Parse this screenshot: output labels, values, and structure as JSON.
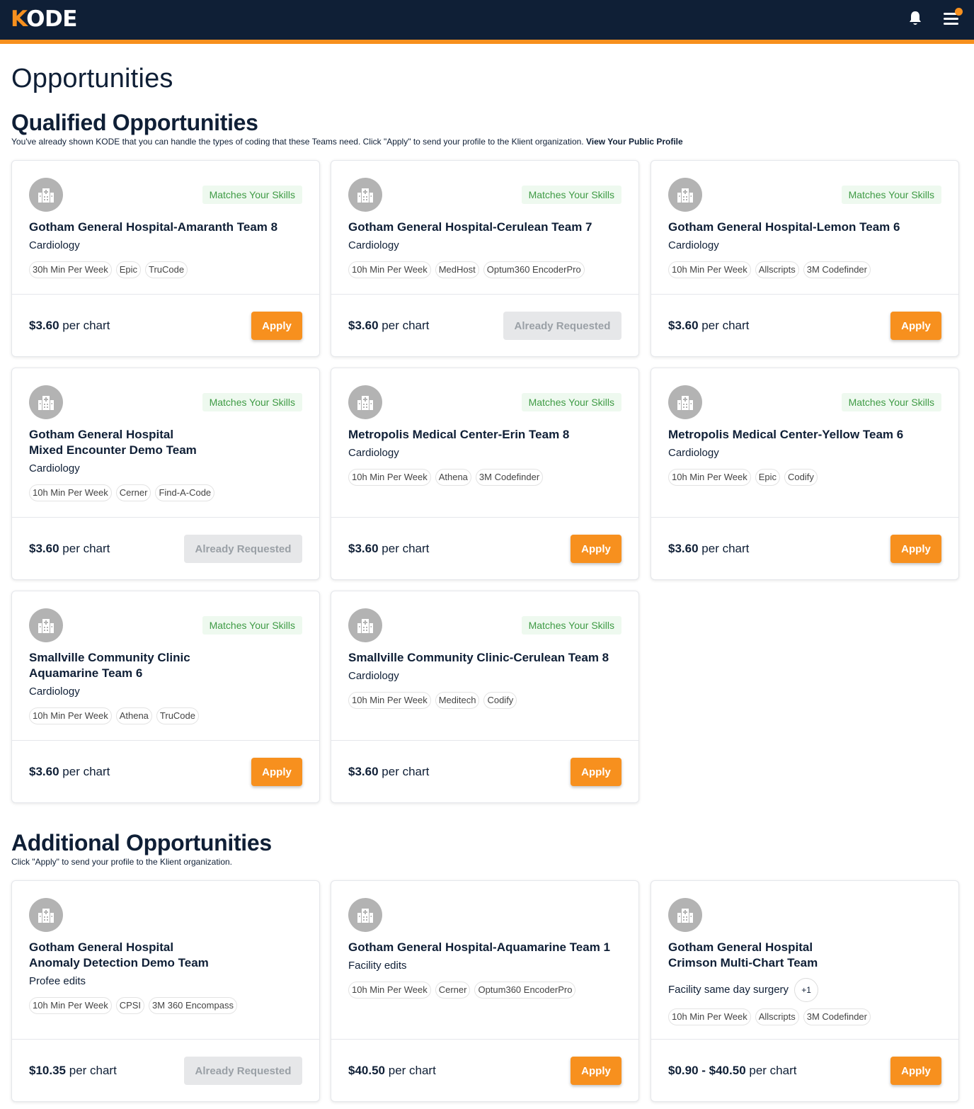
{
  "header": {
    "logo_k": "K",
    "logo_rest": "ODE",
    "notification_count_indicator": true
  },
  "page_title": "Opportunities",
  "qualified": {
    "title": "Qualified Opportunities",
    "description": "You've already shown KODE that you can handle the types of coding that these Teams need. Click \"Apply\" to send your profile to the Klient organization.",
    "profile_link": "View Your Public Profile",
    "cards": [
      {
        "badge": "Matches Your Skills",
        "title_line1": "Gotham General Hospital-Amaranth Team 8",
        "title_line2": "",
        "specialty": "Cardiology",
        "tags": [
          "30h Min Per Week",
          "Epic",
          "TruCode"
        ],
        "price": "$3.60",
        "price_suffix": "per chart",
        "action": "Apply"
      },
      {
        "badge": "Matches Your Skills",
        "title_line1": "Gotham General Hospital-Cerulean Team 7",
        "title_line2": "",
        "specialty": "Cardiology",
        "tags": [
          "10h Min Per Week",
          "MedHost",
          "Optum360 EncoderPro"
        ],
        "price": "$3.60",
        "price_suffix": "per chart",
        "action": "Already Requested"
      },
      {
        "badge": "Matches Your Skills",
        "title_line1": "Gotham General Hospital-Lemon Team 6",
        "title_line2": "",
        "specialty": "Cardiology",
        "tags": [
          "10h Min Per Week",
          "Allscripts",
          "3M Codefinder"
        ],
        "price": "$3.60",
        "price_suffix": "per chart",
        "action": "Apply"
      },
      {
        "badge": "Matches Your Skills",
        "title_line1": "Gotham General Hospital",
        "title_line2": "Mixed Encounter Demo Team",
        "specialty": "Cardiology",
        "tags": [
          "10h Min Per Week",
          "Cerner",
          "Find-A-Code"
        ],
        "price": "$3.60",
        "price_suffix": "per chart",
        "action": "Already Requested"
      },
      {
        "badge": "Matches Your Skills",
        "title_line1": "Metropolis Medical Center-Erin Team 8",
        "title_line2": "",
        "specialty": "Cardiology",
        "tags": [
          "10h Min Per Week",
          "Athena",
          "3M Codefinder"
        ],
        "price": "$3.60",
        "price_suffix": "per chart",
        "action": "Apply"
      },
      {
        "badge": "Matches Your Skills",
        "title_line1": "Metropolis Medical Center-Yellow Team 6",
        "title_line2": "",
        "specialty": "Cardiology",
        "tags": [
          "10h Min Per Week",
          "Epic",
          "Codify"
        ],
        "price": "$3.60",
        "price_suffix": "per chart",
        "action": "Apply"
      },
      {
        "badge": "Matches Your Skills",
        "title_line1": "Smallville Community Clinic",
        "title_line2": "Aquamarine Team 6",
        "specialty": "Cardiology",
        "tags": [
          "10h Min Per Week",
          "Athena",
          "TruCode"
        ],
        "price": "$3.60",
        "price_suffix": "per chart",
        "action": "Apply"
      },
      {
        "badge": "Matches Your Skills",
        "title_line1": "Smallville Community Clinic-Cerulean Team 8",
        "title_line2": "",
        "specialty": "Cardiology",
        "tags": [
          "10h Min Per Week",
          "Meditech",
          "Codify"
        ],
        "price": "$3.60",
        "price_suffix": "per chart",
        "action": "Apply"
      }
    ]
  },
  "additional": {
    "title": "Additional Opportunities",
    "description": "Click \"Apply\" to send your profile to the Klient organization.",
    "cards": [
      {
        "title_line1": "Gotham General Hospital",
        "title_line2": "Anomaly Detection Demo Team",
        "specialty": "Profee edits",
        "extra": "",
        "tags": [
          "10h Min Per Week",
          "CPSI",
          "3M 360 Encompass"
        ],
        "price": "$10.35",
        "price_suffix": "per chart",
        "action": "Already Requested"
      },
      {
        "title_line1": "Gotham General Hospital-Aquamarine Team 1",
        "title_line2": "",
        "specialty": "Facility edits",
        "extra": "",
        "tags": [
          "10h Min Per Week",
          "Cerner",
          "Optum360 EncoderPro"
        ],
        "price": "$40.50",
        "price_suffix": "per chart",
        "action": "Apply"
      },
      {
        "title_line1": "Gotham General Hospital",
        "title_line2": "Crimson Multi-Chart Team",
        "specialty": "Facility same day surgery",
        "extra": "+1",
        "tags": [
          "10h Min Per Week",
          "Allscripts",
          "3M Codefinder"
        ],
        "price": "$0.90 - $40.50",
        "price_suffix": "per chart",
        "action": "Apply"
      }
    ]
  },
  "colors": {
    "navy": "#0f1f36",
    "accent": "#f7901e",
    "match_green": "#3f9b45",
    "disabled_gray": "#e6e7e9"
  }
}
